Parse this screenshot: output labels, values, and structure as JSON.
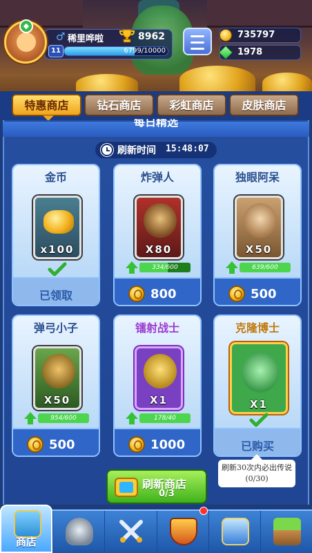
{
  "player": {
    "name": "稀里哗啦",
    "trophies": "8962",
    "level": "11",
    "xp_text": "6799/10000",
    "xp_fraction": 0.68
  },
  "currency": {
    "coins": "735797",
    "gems": "1978"
  },
  "tabs": [
    {
      "label": "特惠商店",
      "active": true
    },
    {
      "label": "钻石商店",
      "active": false
    },
    {
      "label": "彩虹商店",
      "active": false
    },
    {
      "label": "皮肤商店",
      "active": false
    }
  ],
  "section_title": "每日精选",
  "refresh": {
    "label": "刷新时间",
    "time": "15:48:07"
  },
  "items": [
    {
      "name": "金币",
      "qty": "x100",
      "status": "已领取",
      "price": null,
      "fragments": null,
      "rarity": "normal",
      "icon": "coin-pile-icon"
    },
    {
      "name": "炸弹人",
      "qty": "X80",
      "status": null,
      "price": "800",
      "fragments": "334/600",
      "fragment_fraction": 0.56,
      "rarity": "normal",
      "icon": "bomber-icon"
    },
    {
      "name": "独眼阿呆",
      "qty": "X50",
      "status": null,
      "price": "500",
      "fragments": "639/600",
      "fragment_fraction": 1.0,
      "rarity": "normal",
      "icon": "cyclops-icon"
    },
    {
      "name": "弹弓小子",
      "qty": "X50",
      "status": null,
      "price": "500",
      "fragments": "954/600",
      "fragment_fraction": 1.0,
      "rarity": "normal",
      "icon": "slingshot-kid-icon"
    },
    {
      "name": "镭射战士",
      "qty": "X1",
      "status": null,
      "price": "1000",
      "fragments": "178/40",
      "fragment_fraction": 1.0,
      "rarity": "epic",
      "icon": "laser-warrior-icon"
    },
    {
      "name": "克隆博士",
      "qty": "X1",
      "status": "已购买",
      "price": null,
      "fragments": null,
      "rarity": "legendary",
      "icon": "dr-clone-icon"
    }
  ],
  "tooltip": {
    "line1": "刷新30次内必出传说",
    "line2": "(0/30)"
  },
  "refresh_button": {
    "label": "刷新商店",
    "count": "0/3"
  },
  "nav": {
    "shop_label": "商店",
    "items": [
      "shop-icon",
      "knight-helmet-icon",
      "crossed-swords-icon",
      "crown-shield-icon",
      "team-icon",
      "sprout-icon"
    ]
  },
  "colors": {
    "active_tab": "#f1a41c",
    "panel_bg": "#1f4593",
    "claim_green": "#35c235",
    "epic": "#9c3bd0",
    "legendary": "#c07a0c"
  }
}
